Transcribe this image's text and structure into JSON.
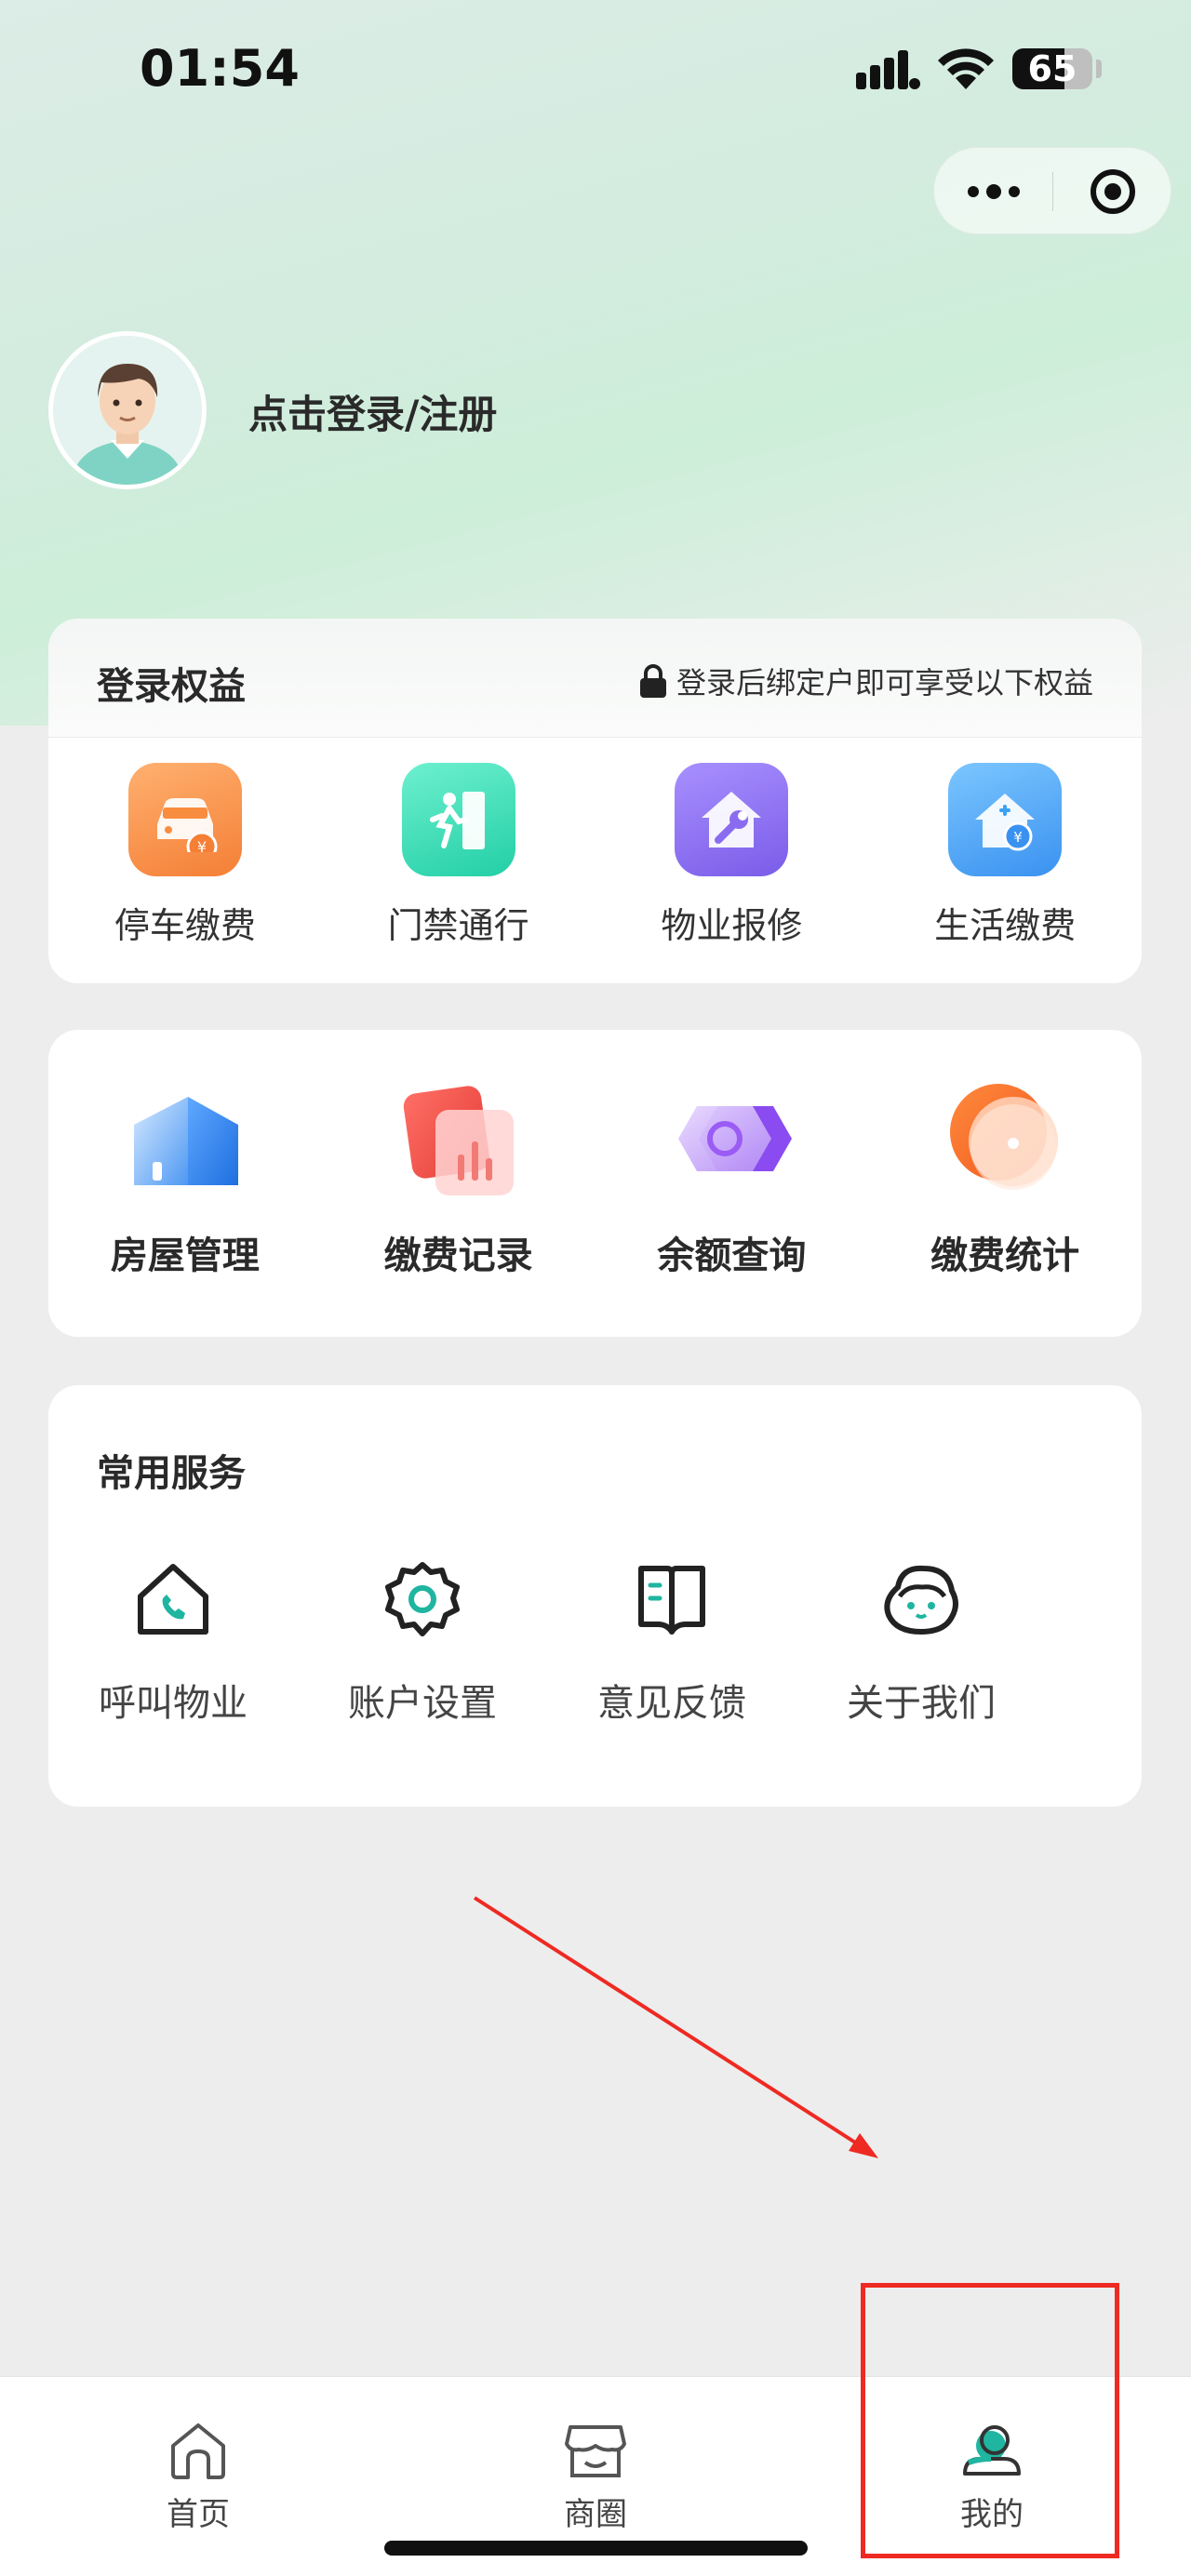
{
  "status_bar": {
    "time": "01:54",
    "battery": "65",
    "battery_level": 0.65
  },
  "profile": {
    "login_label": "点击登录/注册"
  },
  "benefits": {
    "title": "登录权益",
    "hint": "登录后绑定户即可享受以下权益",
    "items": [
      {
        "label": "停车缴费",
        "icon": "parking-fee-icon",
        "color": "#f98d3f"
      },
      {
        "label": "门禁通行",
        "icon": "door-access-icon",
        "color": "#2ed8b0"
      },
      {
        "label": "物业报修",
        "icon": "repair-icon",
        "color": "#8a6cf0"
      },
      {
        "label": "生活缴费",
        "icon": "life-payment-icon",
        "color": "#3aa2f5"
      }
    ]
  },
  "quick_actions": [
    {
      "label": "房屋管理",
      "icon": "house-management-icon"
    },
    {
      "label": "缴费记录",
      "icon": "payment-record-icon"
    },
    {
      "label": "余额查询",
      "icon": "balance-query-icon"
    },
    {
      "label": "缴费统计",
      "icon": "payment-stats-icon"
    }
  ],
  "services": {
    "title": "常用服务",
    "items": [
      {
        "label": "呼叫物业",
        "icon": "call-property-icon"
      },
      {
        "label": "账户设置",
        "icon": "account-settings-icon"
      },
      {
        "label": "意见反馈",
        "icon": "feedback-icon"
      },
      {
        "label": "关于我们",
        "icon": "about-us-icon"
      }
    ]
  },
  "tabbar": {
    "items": [
      {
        "label": "首页",
        "icon": "home-icon"
      },
      {
        "label": "商圈",
        "icon": "shop-icon"
      },
      {
        "label": "我的",
        "icon": "profile-icon",
        "active": true
      }
    ]
  },
  "colors": {
    "accent": "#1fb5a0",
    "annotation": "#ee2a22"
  }
}
